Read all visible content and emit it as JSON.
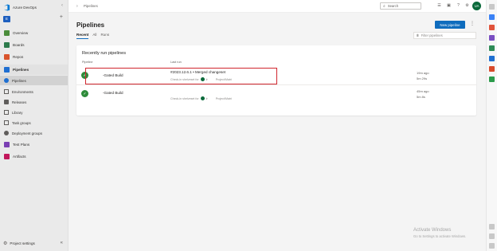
{
  "org": {
    "name": "Azure DevOps",
    "collapse_glyph": "‹"
  },
  "project": {
    "badge": "E",
    "add_glyph": "+"
  },
  "nav": {
    "items": [
      {
        "label": "Overview",
        "color": "#4a8c3a"
      },
      {
        "label": "Boards",
        "color": "#2c7a4b"
      },
      {
        "label": "Repos",
        "color": "#d9542c"
      },
      {
        "label": "Pipelines",
        "color": "#1f6fd1"
      }
    ],
    "sub_items": [
      {
        "label": "Pipelines"
      },
      {
        "label": "Environments"
      },
      {
        "label": "Releases"
      },
      {
        "label": "Library"
      },
      {
        "label": "Task groups"
      },
      {
        "label": "Deployment groups"
      }
    ],
    "after_items": [
      {
        "label": "Test Plans",
        "color": "#7a3fb3"
      },
      {
        "label": "Artifacts",
        "color": "#c2185b"
      }
    ],
    "project_settings": "Project settings",
    "collapse_glyph": "«"
  },
  "topbar": {
    "breadcrumb": "Pipelines",
    "search_placeholder": "Search",
    "avatar_initials": "UA"
  },
  "page": {
    "title": "Pipelines",
    "new_button": "New pipeline",
    "more_glyph": "⋮",
    "tabs": [
      {
        "label": "Recent",
        "active": true
      },
      {
        "label": "All",
        "active": false
      },
      {
        "label": "Runs",
        "active": false
      }
    ],
    "filter_placeholder": "Filter pipelines"
  },
  "recent": {
    "title": "Recently run pipelines",
    "col_pipeline": "Pipeline",
    "col_lastrun": "Last run",
    "rows": [
      {
        "name": "-Gated Build",
        "run_title": "#2023.12.6.1 • Merged changeset",
        "meta_prefix": "Check-in shelveset for",
        "meta_mid": "Ir",
        "meta_suffix": "Project/Matri",
        "time_ago": "19m ago",
        "duration": "5m 29s",
        "highlighted": true
      },
      {
        "name": "-Gated Build",
        "run_title": "",
        "meta_prefix": "Check-in shelveset for",
        "meta_mid": "Ir",
        "meta_suffix": "Project/Matri",
        "time_ago": "45m ago",
        "duration": "5m 8s",
        "highlighted": false
      }
    ]
  },
  "watermark": {
    "line1": "Activate Windows",
    "line2": "Go to Settings to activate Windows."
  },
  "colors": {
    "accent": "#0f6cbd",
    "success": "#2e8b3a",
    "highlight": "#d0262e"
  }
}
